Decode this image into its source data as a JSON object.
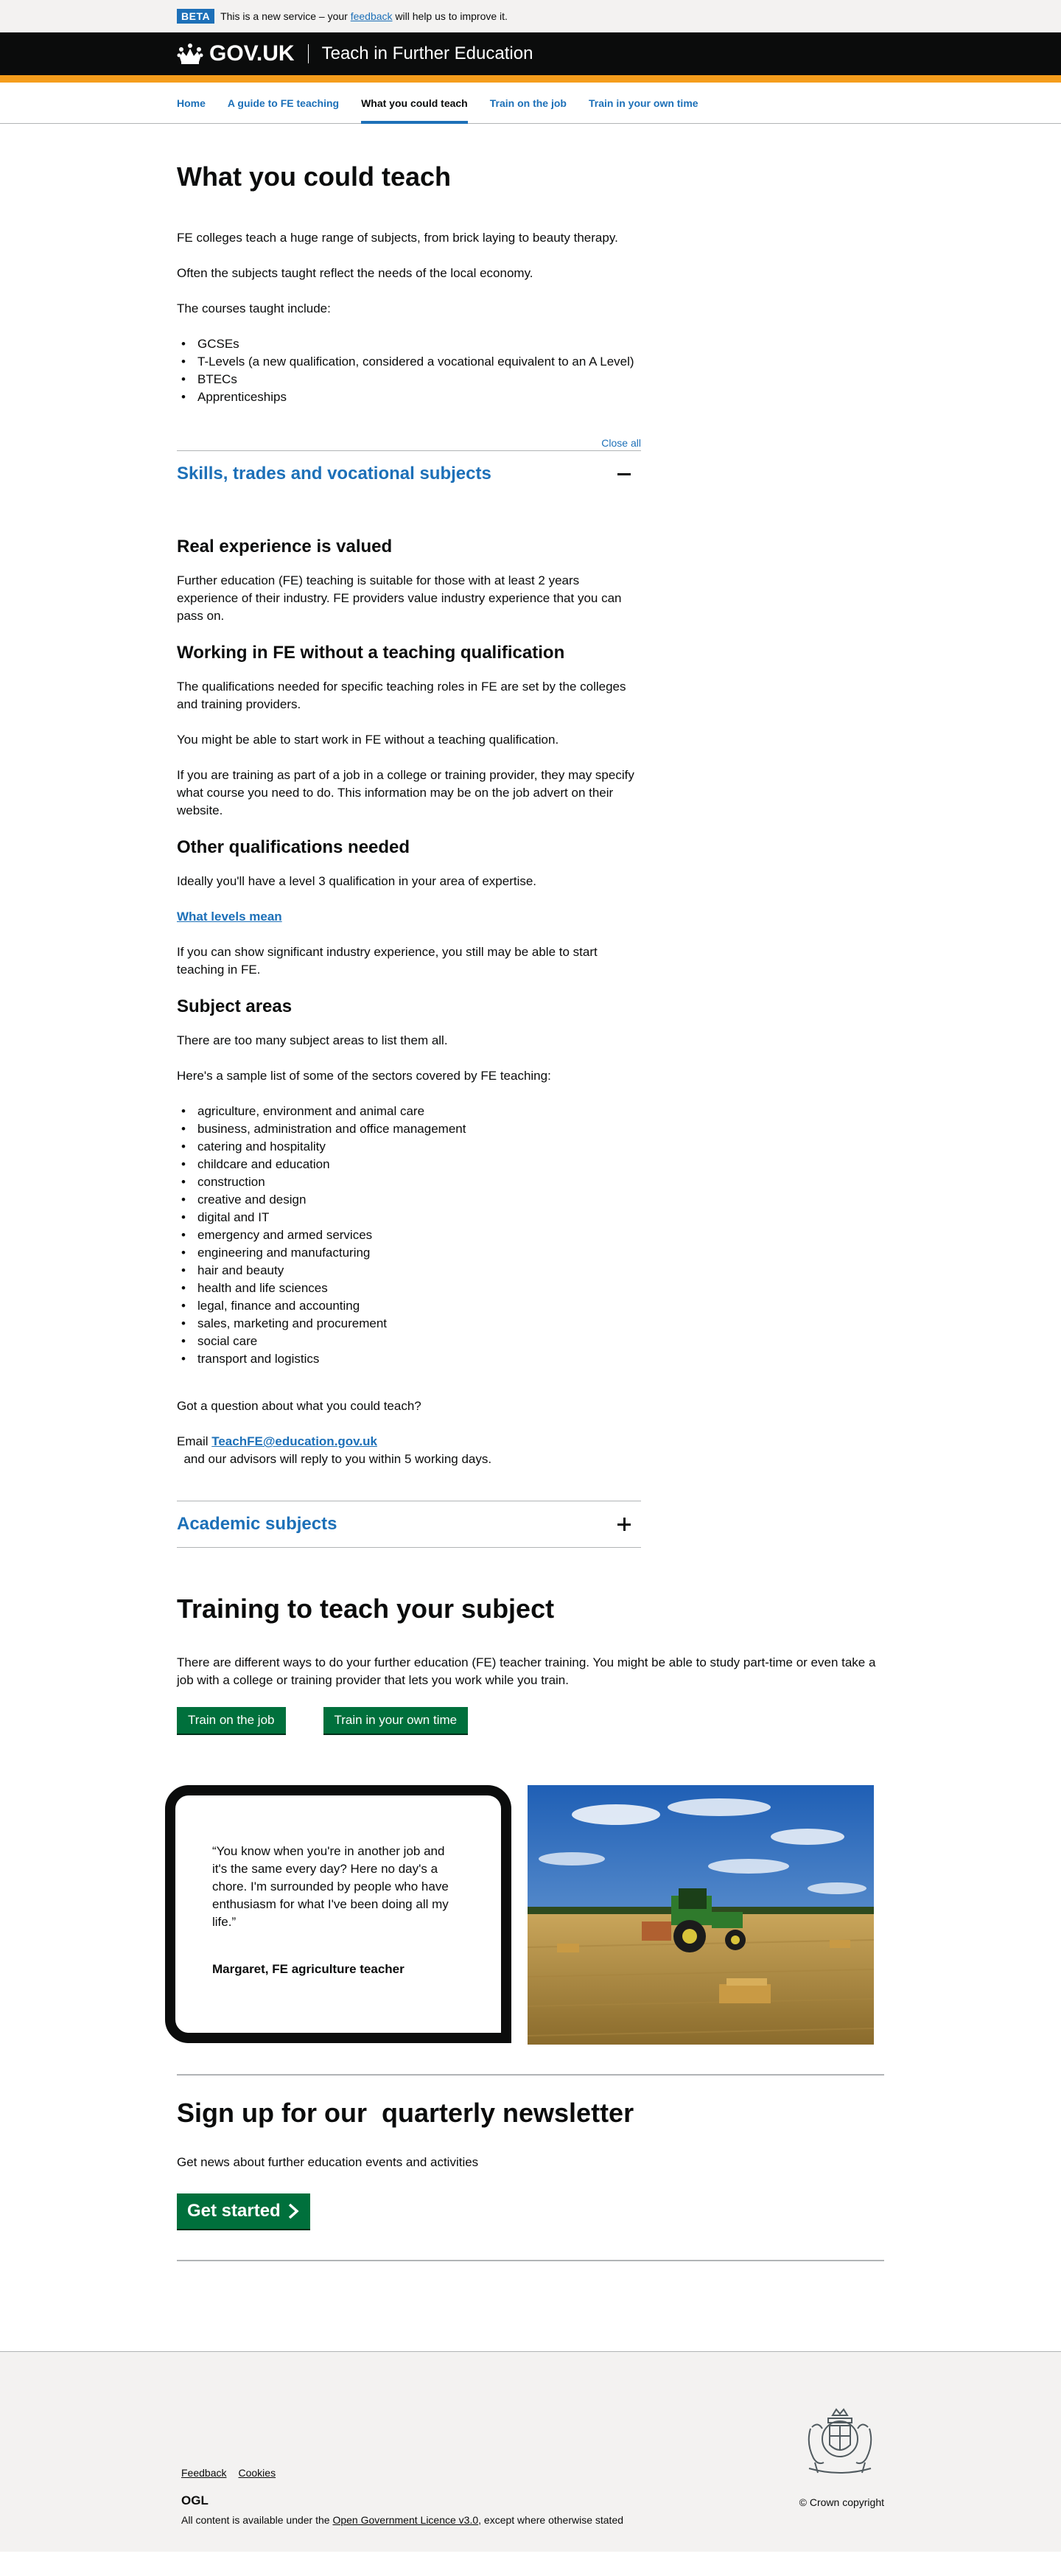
{
  "beta": {
    "tag": "BETA",
    "text_before": "This is a new service – your ",
    "link": "feedback",
    "text_after": " will help us to improve it."
  },
  "header": {
    "logo_text": "GOV.UK",
    "service_name": "Teach in Further Education"
  },
  "nav": {
    "items": [
      {
        "label": "Home"
      },
      {
        "label": "A guide to FE teaching"
      },
      {
        "label": "What you could teach"
      },
      {
        "label": "Train on the job"
      },
      {
        "label": "Train in your own time"
      }
    ]
  },
  "main": {
    "title": "What you could teach",
    "intro": [
      "FE colleges teach a huge range of subjects, from brick laying to beauty therapy.",
      "Often the subjects taught reflect the needs of the local economy.",
      "The courses taught include:"
    ],
    "courses": [
      "GCSEs",
      "T-Levels (a new qualification, considered a vocational equivalent to an A Level)",
      "BTECs",
      "Apprenticeships"
    ]
  },
  "accordion": {
    "close_all": "Close all",
    "section1": {
      "title": "Skills, trades and vocational subjects",
      "h_real": "Real experience is valued",
      "p_real": "Further education (FE) teaching is suitable for those with at least 2 years experience of their industry. FE providers value industry experience that you can pass on.",
      "h_working": "Working in FE without a teaching qualification",
      "p_working1": "The qualifications needed for specific teaching roles in FE are set by the colleges and training providers.",
      "p_working2": "You might be able to start work in FE without a teaching qualification.",
      "p_working3": "If you are training as part of a job in a college or training provider, they may specify what course you need to do. This information may be on the job advert on their website.",
      "h_other": "Other qualifications needed",
      "p_other1": "Ideally you'll have a level 3 qualification in your area of expertise.",
      "link_levels": "What levels mean",
      "p_other2": "If you can show significant industry experience, you still may be able to start teaching in FE.",
      "h_subjects": "Subject areas",
      "p_subjects1": "There are too many subject areas to list them all.",
      "p_subjects2": "Here's a sample list of some of the sectors covered by FE teaching:",
      "sectors": [
        "agriculture, environment and animal care",
        "business, administration and office management",
        "catering and hospitality",
        "childcare and education",
        "construction",
        "creative and design",
        "digital and IT",
        "emergency and armed services",
        "engineering and manufacturing",
        "hair and beauty",
        "health and life sciences",
        "legal, finance and accounting",
        "sales, marketing and procurement",
        "social care",
        "transport and logistics"
      ],
      "question": "Got a question about what you could teach?",
      "email_prefix": "Email ",
      "email": "TeachFE@education.gov.uk",
      "email_suffix": "  and our advisors will reply to you within 5 working days."
    },
    "section2": {
      "title": "Academic subjects"
    }
  },
  "training": {
    "title": "Training to teach your subject",
    "text": "There are different ways to do your further education (FE) teacher training. You might be able to study part-time or even take a job with a college or training provider that lets you work while you train.",
    "btn_job": "Train on the job",
    "btn_own": "Train in your own time"
  },
  "quote": {
    "text": "“You know when you're in another job and it's the same every day? Here no day's a chore. I'm surrounded by people who have enthusiasm for what I've been doing all my life.”",
    "author": "Margaret, FE agriculture teacher"
  },
  "newsletter": {
    "title": "Sign up for our  quarterly newsletter",
    "text": "Get news about further education events and activities",
    "button": "Get started"
  },
  "footer": {
    "links": [
      {
        "label": "Feedback"
      },
      {
        "label": "Cookies"
      }
    ],
    "ogl": "OGL",
    "licence_before": "All content is available under the ",
    "licence_link": "Open Government Licence v3.0",
    "licence_after": ", except where otherwise stated",
    "copyright": "© Crown copyright"
  },
  "colors": {
    "link": "#1d70b8",
    "header_bg": "#0b0c0c",
    "header_stripe": "#f59d1c",
    "button_green": "#00703c",
    "footer_bg": "#f3f2f1"
  },
  "icons": [
    "crown-icon",
    "minus-icon",
    "plus-icon",
    "chevron-right-icon",
    "royal-coat-of-arms-icon"
  ]
}
